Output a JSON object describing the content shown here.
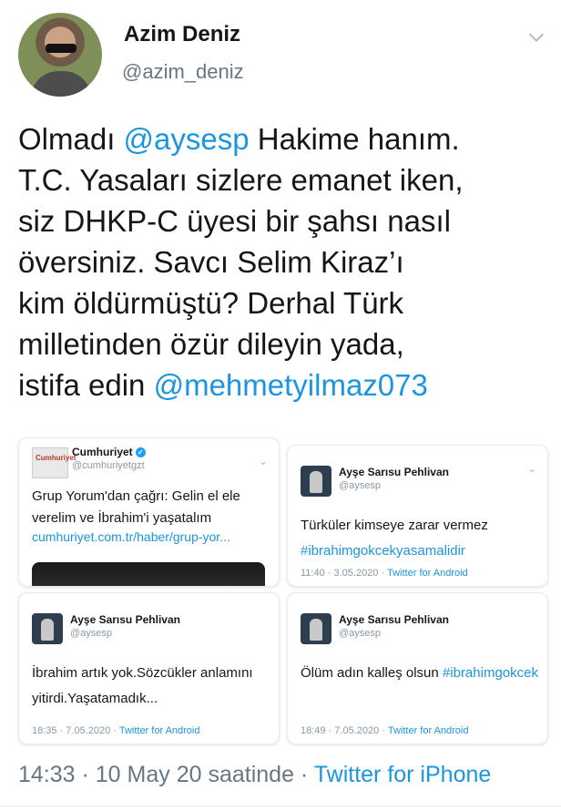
{
  "author": {
    "name": "Azim Deniz",
    "handle": "@azim_deniz"
  },
  "tweet": {
    "pre": "Olmadı ",
    "mention1": "@aysesp",
    "mid": " Hakime hanım.\nT.C. Yasaları sizlere emanet iken,\nsiz DHKP-C üyesi bir şahsı nasıl\növersiniz. Savcı Selim Kiraz’ı\nkim öldürmüştü?  Derhal Türk\nmilletinden özür dileyin yada,\nistifa edin ",
    "mention2": "@mehmetyilmaz073"
  },
  "cards": {
    "cumhuriyet": {
      "logo_text": "Cumhuriyet",
      "name": "Cumhuriyet",
      "handle": "@cumhuriyetgzt",
      "text": "Grup Yorum'dan çağrı: Gelin el ele verelim ve İbrahim'i yaşatalım",
      "link": "cumhuriyet.com.tr/haber/grup-yor..."
    },
    "c2": {
      "name": "Ayşe Sarısu Pehlivan",
      "handle": "@aysesp",
      "text_pre": "Türküler kimseye zarar vermez ",
      "tag": "#ibrahimgokcekyasamalidir",
      "time": "11:40 · 3.05.2020 · ",
      "source": "Twitter for Android"
    },
    "c3": {
      "name": "Ayşe Sarısu Pehlivan",
      "handle": "@aysesp",
      "text": "İbrahim artık yok.Sözcükler anlamını yitirdi.Yaşatamadık...",
      "time": "18:35 · 7.05.2020 · ",
      "source": "Twitter for Android"
    },
    "c4": {
      "name": "Ayşe Sarısu Pehlivan",
      "handle": "@aysesp",
      "text_pre": "Ölüm  adın kalleş olsun ",
      "tag": "#ibrahimgokcek",
      "time": "18:49 · 7.05.2020 · ",
      "source": "Twitter for Android"
    }
  },
  "footer": {
    "time": "14:33 · 10 May 20 saatinde · ",
    "client": "Twitter for iPhone"
  },
  "icons": {
    "chevron": "chevron-down-icon",
    "verified": "verified-badge-icon"
  },
  "colors": {
    "link": "#1b95e0",
    "secondary": "#657786"
  }
}
